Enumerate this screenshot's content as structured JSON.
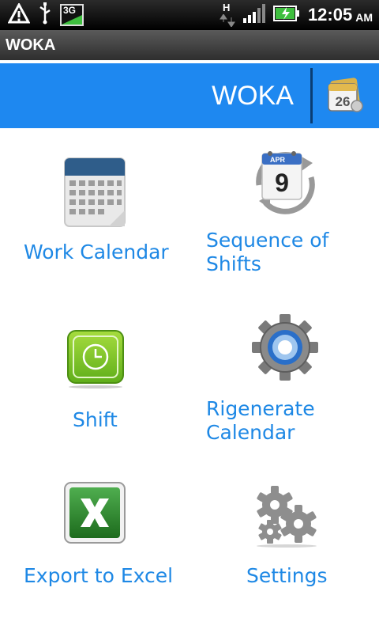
{
  "app_title": "WOKA",
  "status": {
    "time": "12:05",
    "ampm": "AM",
    "network_badge": "3G",
    "data_indicator": "H"
  },
  "header": {
    "title": "WOKA",
    "action_icon": "calendar-26-icon"
  },
  "menu": {
    "work_calendar": {
      "label": "Work Calendar",
      "icon": "grid-calendar-icon"
    },
    "sequence_of_shifts": {
      "line1": "Sequence of",
      "line2": "Shifts",
      "icon": "rotating-calendar-icon",
      "icon_month": "APR",
      "icon_day": "9"
    },
    "shift": {
      "label": "Shift",
      "icon": "clock-icon"
    },
    "regenerate_calendar": {
      "line1": "Rigenerate",
      "line2": "Calendar",
      "icon": "gear-icon"
    },
    "export_excel": {
      "label": "Export to Excel",
      "icon": "excel-icon"
    },
    "settings": {
      "label": "Settings",
      "icon": "gears-icon"
    }
  },
  "colors": {
    "accent": "#1e88f0",
    "link_text": "#1e88e5"
  }
}
